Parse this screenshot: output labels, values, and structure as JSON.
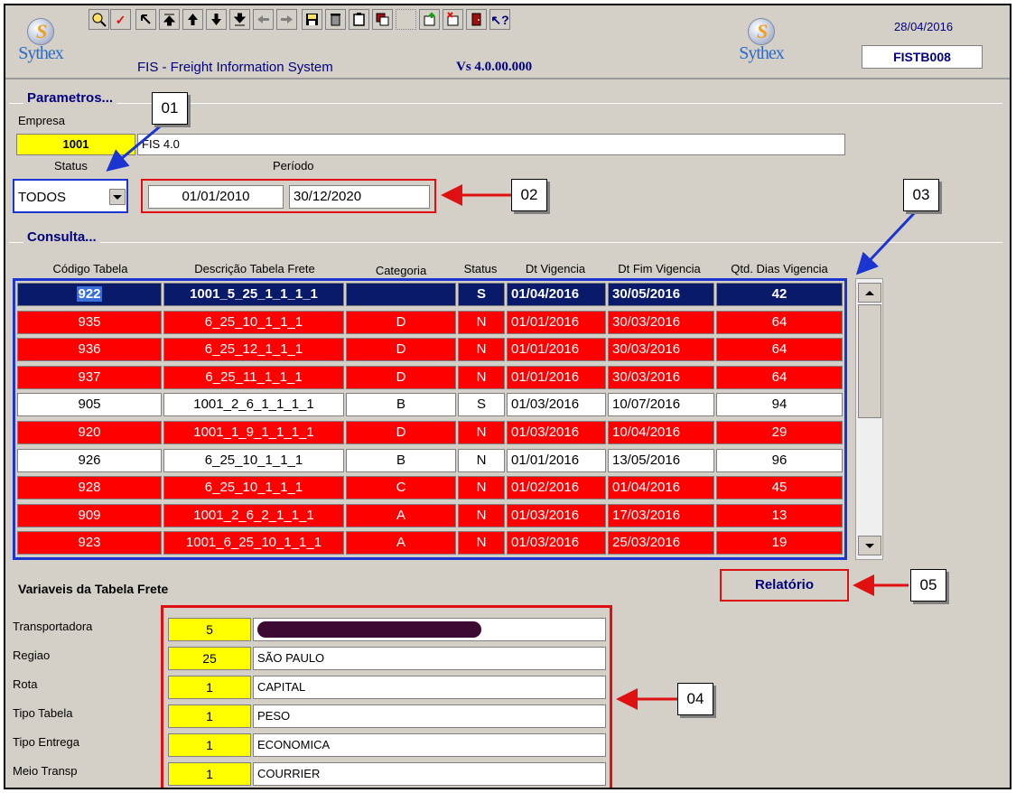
{
  "header": {
    "brand": "Sythex",
    "brand_letter": "S",
    "app_title": "FIS - Freight Information System",
    "version": "Vs 4.0.00.000",
    "date": "28/04/2016",
    "screen_code": "FISTB008",
    "toolbar_icons": [
      "search-person-icon",
      "check-icon",
      "arrow-up-left-icon",
      "arrow-first-icon",
      "arrow-up-icon",
      "arrow-down-icon",
      "arrow-last-icon",
      "arrow-left-icon",
      "arrow-right-icon",
      "save-icon",
      "delete-icon",
      "clipboard-icon",
      "copy-icon",
      "insert-icon",
      "add-record-icon",
      "delete-record-icon",
      "exit-door-icon",
      "help-pointer-icon"
    ]
  },
  "parametros": {
    "title": "Parametros...",
    "empresa_label": "Empresa",
    "empresa_code": "1001",
    "empresa_name": "FIS 4.0",
    "status_label": "Status",
    "status_value": "TODOS",
    "periodo_label": "Período",
    "period_start": "01/01/2010",
    "period_end": "30/12/2020"
  },
  "consulta": {
    "title": "Consulta...",
    "columns": [
      "Código Tabela",
      "Descrição Tabela Frete",
      "Categoria",
      "Status",
      "Dt Vigencia",
      "Dt Fim Vigencia",
      "Qtd. Dias Vigencia"
    ],
    "rows": [
      {
        "code": "922",
        "desc": "1001_5_25_1_1_1_1",
        "cat": "",
        "status": "S",
        "start": "01/04/2016",
        "end": "30/05/2016",
        "days": "42",
        "style": "sel"
      },
      {
        "code": "935",
        "desc": "6_25_10_1_1_1",
        "cat": "D",
        "status": "N",
        "start": "01/01/2016",
        "end": "30/03/2016",
        "days": "64",
        "style": "red"
      },
      {
        "code": "936",
        "desc": "6_25_12_1_1_1",
        "cat": "D",
        "status": "N",
        "start": "01/01/2016",
        "end": "30/03/2016",
        "days": "64",
        "style": "red"
      },
      {
        "code": "937",
        "desc": "6_25_11_1_1_1",
        "cat": "D",
        "status": "N",
        "start": "01/01/2016",
        "end": "30/03/2016",
        "days": "64",
        "style": "red"
      },
      {
        "code": "905",
        "desc": "1001_2_6_1_1_1_1",
        "cat": "B",
        "status": "S",
        "start": "01/03/2016",
        "end": "10/07/2016",
        "days": "94",
        "style": "white"
      },
      {
        "code": "920",
        "desc": "1001_1_9_1_1_1_1",
        "cat": "D",
        "status": "N",
        "start": "01/03/2016",
        "end": "10/04/2016",
        "days": "29",
        "style": "red"
      },
      {
        "code": "926",
        "desc": "6_25_10_1_1_1",
        "cat": "B",
        "status": "N",
        "start": "01/01/2016",
        "end": "13/05/2016",
        "days": "96",
        "style": "white"
      },
      {
        "code": "928",
        "desc": "6_25_10_1_1_1",
        "cat": "C",
        "status": "N",
        "start": "01/02/2016",
        "end": "01/04/2016",
        "days": "45",
        "style": "red"
      },
      {
        "code": "909",
        "desc": "1001_2_6_2_1_1_1",
        "cat": "A",
        "status": "N",
        "start": "01/03/2016",
        "end": "17/03/2016",
        "days": "13",
        "style": "red"
      },
      {
        "code": "923",
        "desc": "1001_6_25_10_1_1_1",
        "cat": "A",
        "status": "N",
        "start": "01/03/2016",
        "end": "25/03/2016",
        "days": "19",
        "style": "red"
      }
    ]
  },
  "variaveis": {
    "title": "Variaveis da Tabela Frete",
    "items": [
      {
        "label": "Transportadora",
        "code": "5",
        "desc": ""
      },
      {
        "label": "Regiao",
        "code": "25",
        "desc": "SÃO PAULO"
      },
      {
        "label": "Rota",
        "code": "1",
        "desc": "CAPITAL"
      },
      {
        "label": "Tipo Tabela",
        "code": "1",
        "desc": "PESO"
      },
      {
        "label": "Tipo Entrega",
        "code": "1",
        "desc": "ECONOMICA"
      },
      {
        "label": "Meio Transp",
        "code": "1",
        "desc": "COURRIER"
      }
    ]
  },
  "relatorio_label": "Relatório",
  "callouts": [
    "01",
    "02",
    "03",
    "04",
    "05"
  ],
  "colors": {
    "window_bg": "#d4d0c8",
    "title_blue": "#000080",
    "row_red": "#ff0000",
    "row_selected": "#0a1a6a",
    "code_yellow": "#ffff00",
    "annotation_blue": "#1a35d0",
    "annotation_red": "#e01010"
  }
}
